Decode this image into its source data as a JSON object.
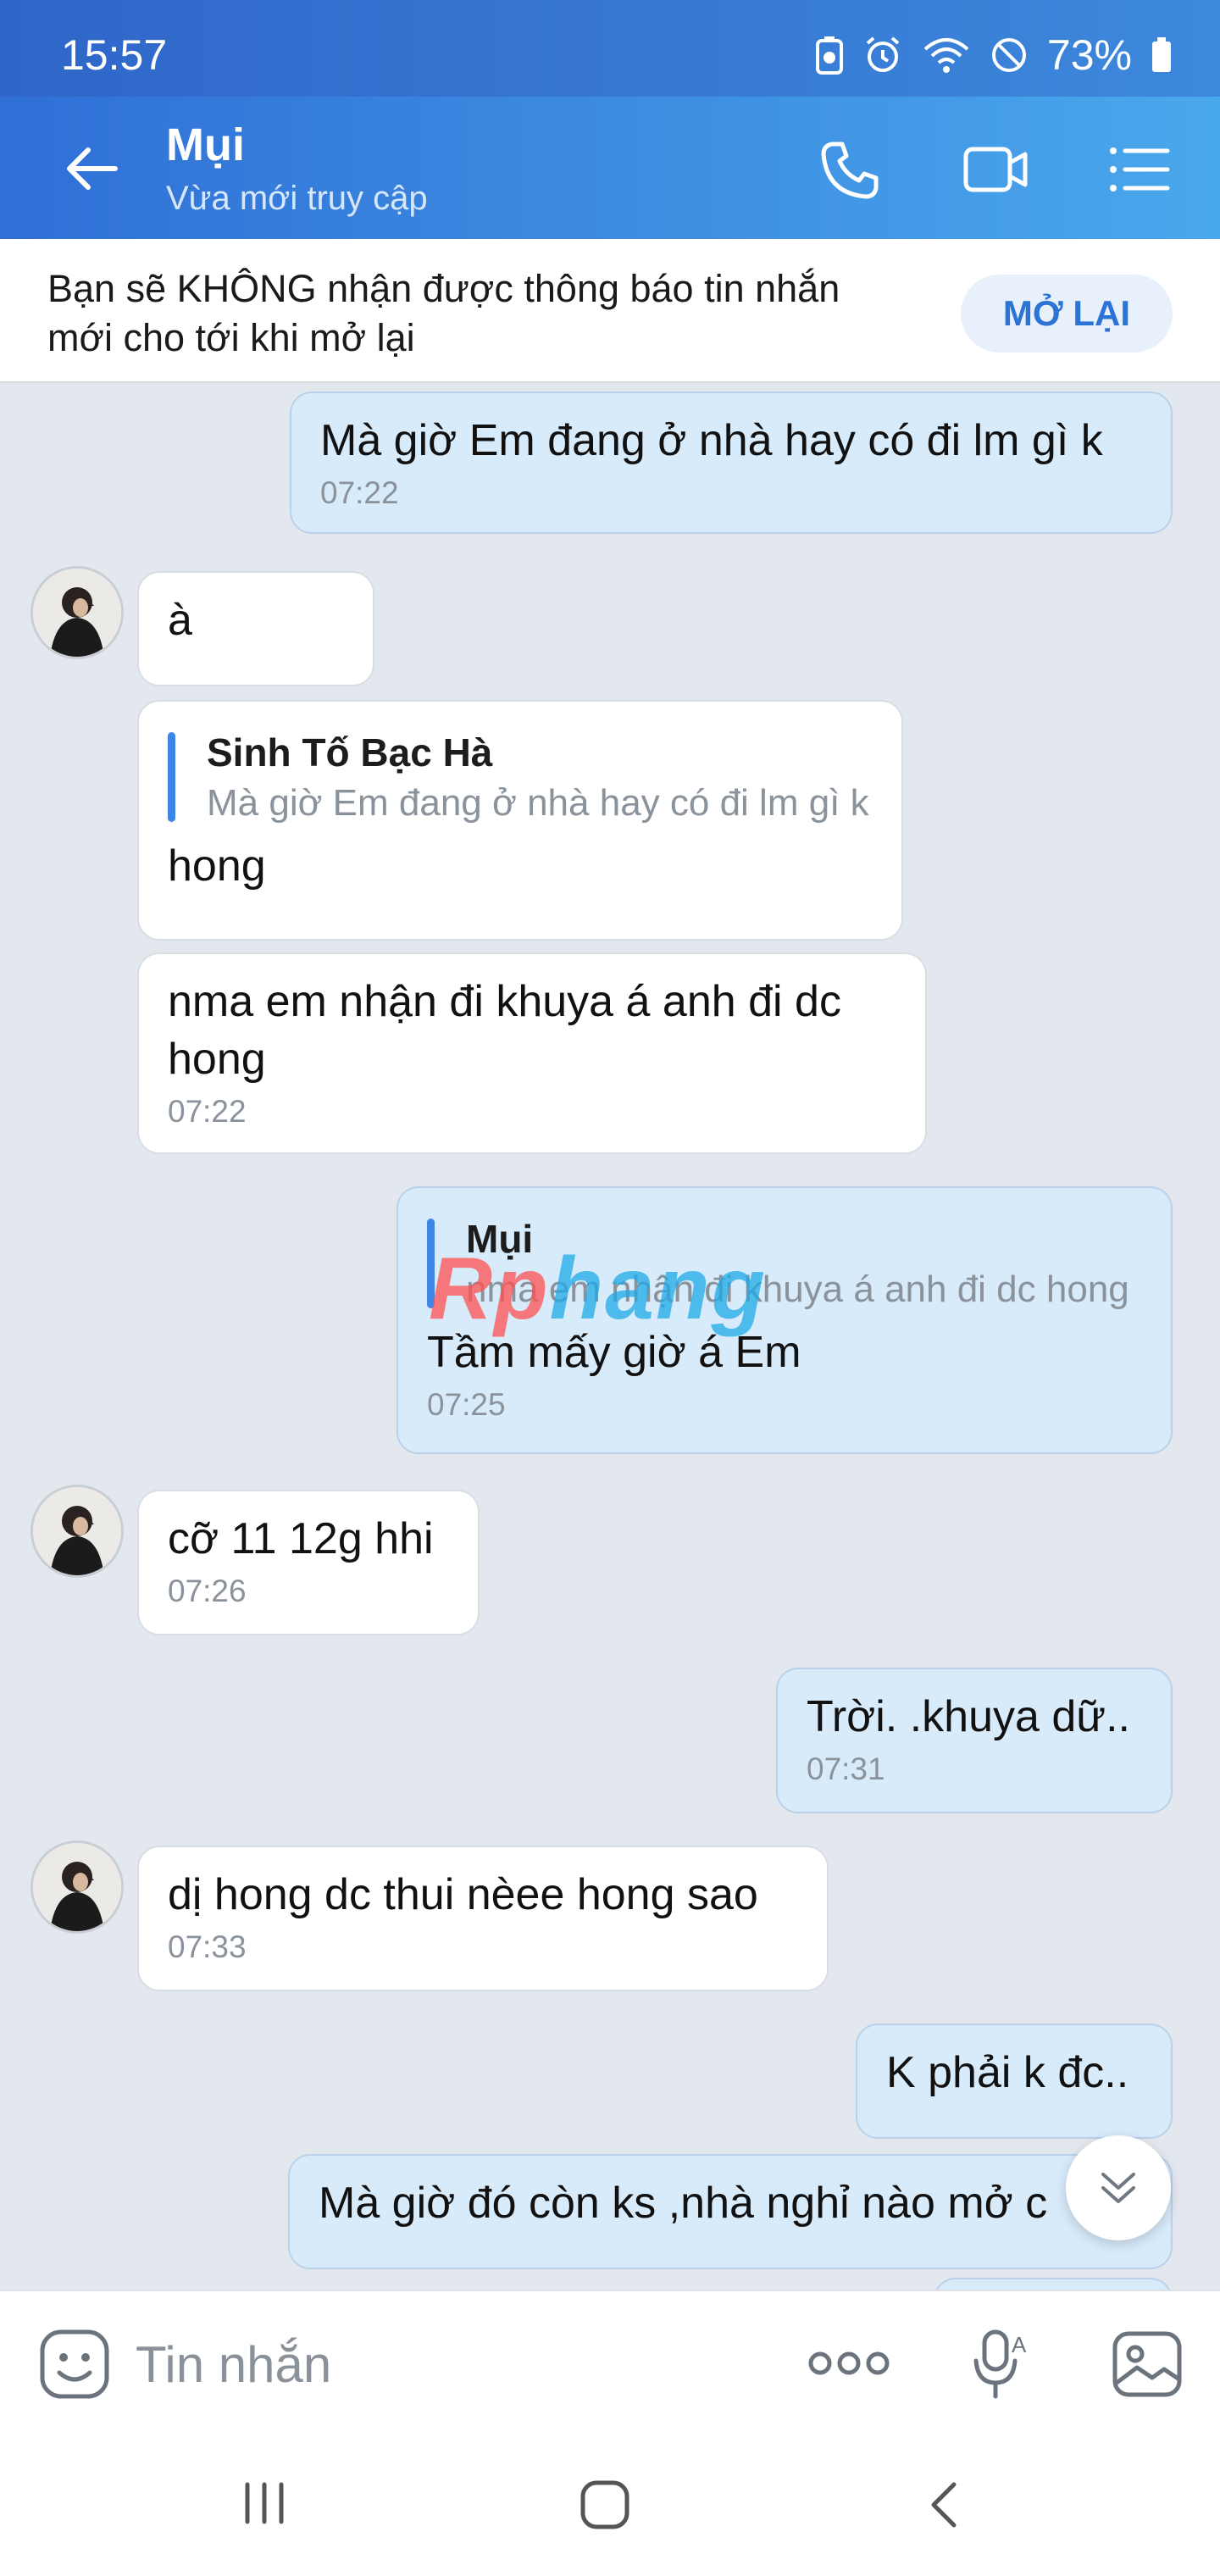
{
  "status_bar": {
    "time": "15:57",
    "battery": "73%"
  },
  "header": {
    "contact_name": "Mụi",
    "contact_status": "Vừa mới truy cập"
  },
  "notice": {
    "text": "Bạn sẽ KHÔNG nhận được thông báo tin nhắn mới cho tới khi mở lại",
    "button": "MỞ LẠI"
  },
  "messages": [
    {
      "dir": "out",
      "text": "Mà giờ Em đang ở nhà hay có đi lm gì k",
      "time": "07:22"
    },
    {
      "dir": "in",
      "text": "à"
    },
    {
      "dir": "in",
      "quote_name": "Sinh Tố Bạc Hà",
      "quote_text": "Mà giờ Em đang ở nhà hay có đi lm gì k",
      "text": "hong"
    },
    {
      "dir": "in",
      "text": "nma em nhận đi khuya á anh đi dc hong",
      "time": "07:22"
    },
    {
      "dir": "out",
      "quote_name": "Mụi",
      "quote_text": "nma em nhận đi khuya á anh đi dc hong",
      "text": "Tầm mấy giờ á Em",
      "time": "07:25"
    },
    {
      "dir": "in",
      "text": "cỡ 11 12g hhi",
      "time": "07:26"
    },
    {
      "dir": "out",
      "text": "Trời. .khuya dữ..",
      "time": "07:31"
    },
    {
      "dir": "in",
      "text": "dị hong dc thui nèee hong sao",
      "time": "07:33"
    },
    {
      "dir": "out",
      "text": "K phải k đc.."
    },
    {
      "dir": "out",
      "text": "Mà giờ đó còn ks ,nhà nghỉ nào mở c"
    }
  ],
  "watermark": {
    "part1": "Rp",
    "part2": "hang"
  },
  "input": {
    "placeholder": "Tin nhắn"
  },
  "icons": {
    "back": "arrow-left-icon",
    "call": "phone-icon",
    "video": "video-camera-icon",
    "menu": "list-menu-icon",
    "sticker": "sticker-face-icon",
    "more": "more-dots-icon",
    "voice": "microphone-icon",
    "image": "image-icon",
    "scroll_down": "chevron-double-down-icon"
  },
  "colors": {
    "header_start": "#2f6fd6",
    "header_end": "#4aa8ec",
    "outgoing_bubble": "#d8ebfb",
    "accent": "#2b74d6"
  }
}
